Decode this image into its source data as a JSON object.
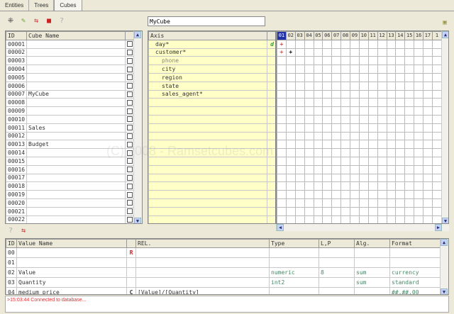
{
  "tabs": [
    "Entities",
    "Trees",
    "Cubes"
  ],
  "watermark": "(C) 2008 - Ramsetcubes.com",
  "cubes": {
    "headers": [
      "ID",
      "Cube Name"
    ],
    "rows": [
      [
        "00001",
        ""
      ],
      [
        "00002",
        ""
      ],
      [
        "00003",
        ""
      ],
      [
        "00004",
        ""
      ],
      [
        "00005",
        ""
      ],
      [
        "00006",
        ""
      ],
      [
        "00007",
        "MyCube"
      ],
      [
        "00008",
        ""
      ],
      [
        "00009",
        ""
      ],
      [
        "00010",
        ""
      ],
      [
        "00011",
        "Sales"
      ],
      [
        "00012",
        ""
      ],
      [
        "00013",
        "Budget"
      ],
      [
        "00014",
        ""
      ],
      [
        "00015",
        ""
      ],
      [
        "00016",
        ""
      ],
      [
        "00017",
        ""
      ],
      [
        "00018",
        ""
      ],
      [
        "00019",
        ""
      ],
      [
        "00020",
        ""
      ],
      [
        "00021",
        ""
      ],
      [
        "00022",
        ""
      ]
    ]
  },
  "cube_name": "MyCube",
  "axis": {
    "header": "Axis",
    "rows": [
      {
        "label": "day*",
        "indent": 1,
        "flag": "d"
      },
      {
        "label": "customer*",
        "indent": 1,
        "flag": ""
      },
      {
        "label": "phone",
        "indent": 2,
        "flag": ""
      },
      {
        "label": "city",
        "indent": 2,
        "flag": ""
      },
      {
        "label": "region",
        "indent": 2,
        "flag": ""
      },
      {
        "label": "state",
        "indent": 2,
        "flag": ""
      },
      {
        "label": "sales_agent*",
        "indent": 2,
        "flag": ""
      }
    ]
  },
  "grid": {
    "columns": [
      "01",
      "02",
      "03",
      "04",
      "05",
      "06",
      "07",
      "08",
      "09",
      "10",
      "11",
      "12",
      "13",
      "14",
      "15",
      "16",
      "17",
      "1"
    ],
    "marks": [
      [
        "+",
        ""
      ],
      [
        "+",
        "+"
      ]
    ]
  },
  "values": {
    "headers": [
      "ID",
      "Value Name",
      "",
      "REL.",
      "Type",
      "L,P",
      "Alg.",
      "Format"
    ],
    "rows": [
      [
        "00",
        "",
        "R",
        "",
        "",
        "",
        "",
        ""
      ],
      [
        "01",
        "",
        "",
        "",
        "",
        "",
        "",
        ""
      ],
      [
        "02",
        "Value",
        "",
        "",
        "numeric",
        "8",
        "sum",
        "currency"
      ],
      [
        "03",
        "Quantity",
        "",
        "",
        "int2",
        "",
        "sum",
        "standard"
      ],
      [
        "04",
        "medium_price",
        "C",
        "[Value]/[Quantity]",
        "",
        "",
        "",
        "##,##.00"
      ]
    ]
  },
  "log": ">15:03:44 Connected to database..."
}
